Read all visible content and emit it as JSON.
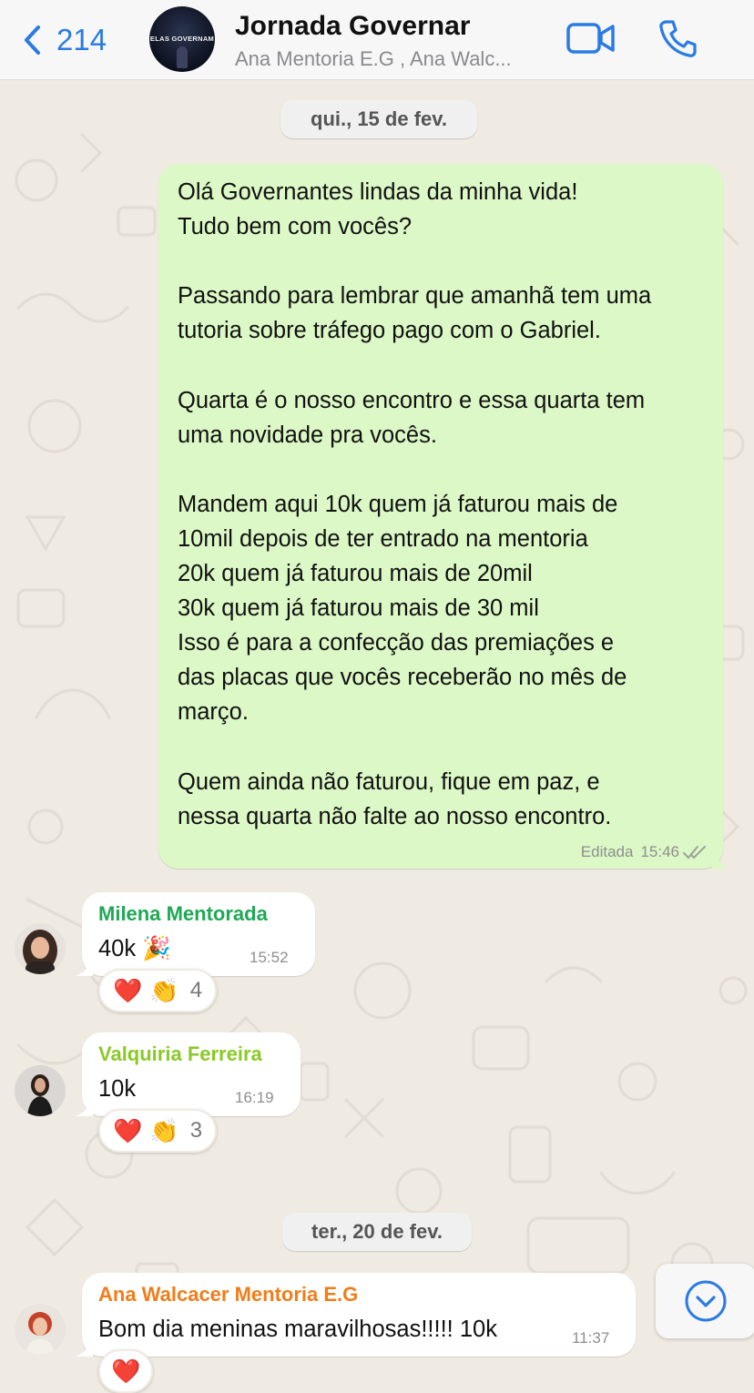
{
  "header": {
    "back_count": "214",
    "group_title": "Jornada Governar",
    "group_subtitle": "Ana Mentoria E.G , Ana Walc...",
    "avatar_logo_text": "ELAS GOVERNAM"
  },
  "dates": [
    "qui., 15 de fev.",
    "ter., 20 de fev."
  ],
  "messages": [
    {
      "direction": "out",
      "text": "Olá Governantes lindas da minha vida!\nTudo bem com vocês?\n\nPassando para lembrar que amanhã tem uma\ntutoria sobre tráfego pago com o Gabriel.\n\nQuarta é o nosso encontro e essa quarta tem\numa novidade pra vocês.\n\nMandem aqui 10k quem já faturou mais de\n10mil depois de ter entrado na mentoria\n20k quem já faturou mais de 20mil\n30k quem já faturou mais de 30 mil\nIsso é para a confecção das premiações e\ndas placas que vocês receberão no mês de\nmarço.\n\nQuem ainda não faturou, fique em paz, e\nnessa quarta não falte ao nosso encontro.",
      "edited_label": "Editada",
      "time": "15:46"
    },
    {
      "direction": "in",
      "sender": "Milena Mentorada",
      "sender_color": "#1fa855",
      "text": "40k 🎉",
      "time": "15:52",
      "reactions": {
        "emojis": [
          "❤️",
          "👏"
        ],
        "count": "4"
      }
    },
    {
      "direction": "in",
      "sender": "Valquiria Ferreira",
      "sender_color": "#8ac926",
      "text": "10k",
      "time": "16:19",
      "reactions": {
        "emojis": [
          "❤️",
          "👏"
        ],
        "count": "3"
      }
    },
    {
      "direction": "in",
      "sender": "Ana Walcacer Mentoria E.G",
      "sender_color": "#f07d1a",
      "text": "Bom dia meninas maravilhosas!!!!! 10k",
      "time": "11:37",
      "reactions": {
        "emojis": [
          "❤️"
        ],
        "count": ""
      }
    }
  ],
  "icons": {
    "back": "chevron-left-icon",
    "video": "video-camera-icon",
    "call": "phone-icon",
    "read": "double-check-icon",
    "scroll": "chevron-down-icon"
  },
  "colors": {
    "accent": "#2a7be4",
    "outgoing_bubble": "#dcf8c6",
    "incoming_bubble": "#ffffff",
    "chat_background": "#efeae2"
  }
}
